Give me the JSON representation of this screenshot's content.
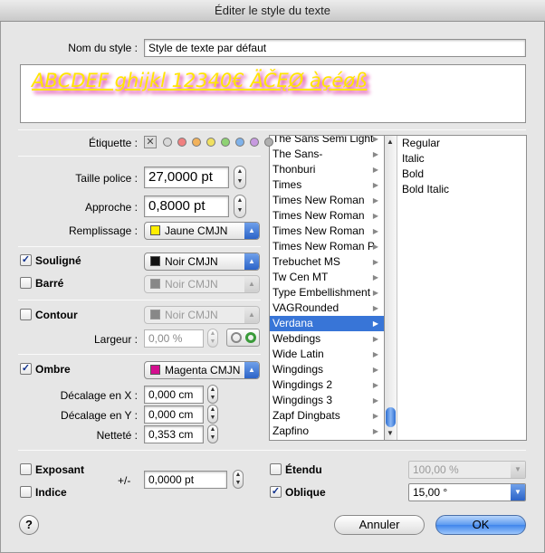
{
  "window": {
    "title": "Éditer le style du texte"
  },
  "style_name": {
    "label": "Nom du style :",
    "value": "Style de texte par défaut"
  },
  "preview": {
    "text": "ABCDEF ghijkl 12340€ ÄČĘØ àçéøß",
    "color": "#ffe600",
    "shadow": "#d40f8f"
  },
  "tag": {
    "label": "Étiquette :",
    "colors": [
      "#d8d8d8",
      "#f08080",
      "#f2b25b",
      "#f0e060",
      "#8ed273",
      "#7fb2ea",
      "#c79ae0",
      "#b0b0b0"
    ]
  },
  "font_size": {
    "label": "Taille police :",
    "value": "27,0000 pt"
  },
  "tracking": {
    "label": "Approche :",
    "value": "0,8000 pt"
  },
  "fill": {
    "label": "Remplissage :",
    "value": "Jaune CMJN",
    "swatch": "#ffee00"
  },
  "underline": {
    "label": "Souligné",
    "checked": true,
    "color": "Noir CMJN",
    "swatch": "#111111"
  },
  "strike": {
    "label": "Barré",
    "checked": false,
    "color": "Noir CMJN",
    "swatch": "#888888"
  },
  "outline": {
    "label": "Contour",
    "checked": false,
    "color": "Noir CMJN",
    "swatch": "#888888",
    "width_label": "Largeur :",
    "width_value": "0,00 %"
  },
  "shadow": {
    "label": "Ombre",
    "checked": true,
    "color": "Magenta CMJN",
    "swatch": "#d40f8f",
    "offset_x_label": "Décalage en X :",
    "offset_x": "0,000 cm",
    "offset_y_label": "Décalage en Y :",
    "offset_y": "0,000 cm",
    "sharpness_label": "Netteté :",
    "sharpness": "0,353 cm"
  },
  "fonts": [
    "The Sans Semi Light",
    "The Sans-",
    "Thonburi",
    "Times",
    "Times New Roman",
    "Times New Roman",
    "Times New Roman",
    "Times New Roman P",
    "Trebuchet MS",
    "Tw Cen MT",
    "Type Embellishment",
    "VAGRounded",
    "Verdana",
    "Webdings",
    "Wide Latin",
    "Wingdings",
    "Wingdings 2",
    "Wingdings 3",
    "Zapf Dingbats",
    "Zapfino"
  ],
  "selected_font_index": 12,
  "styles": [
    "Regular",
    "Italic",
    "Bold",
    "Bold Italic"
  ],
  "superscript": {
    "label": "Exposant",
    "checked": false
  },
  "subscript": {
    "label": "Indice",
    "checked": false
  },
  "offset": {
    "label": "+/-",
    "value": "0,0000 pt"
  },
  "extended": {
    "label": "Étendu",
    "checked": false,
    "value": "100,00 %"
  },
  "oblique": {
    "label": "Oblique",
    "checked": true,
    "value": "15,00 °"
  },
  "buttons": {
    "cancel": "Annuler",
    "ok": "OK",
    "help": "?"
  }
}
